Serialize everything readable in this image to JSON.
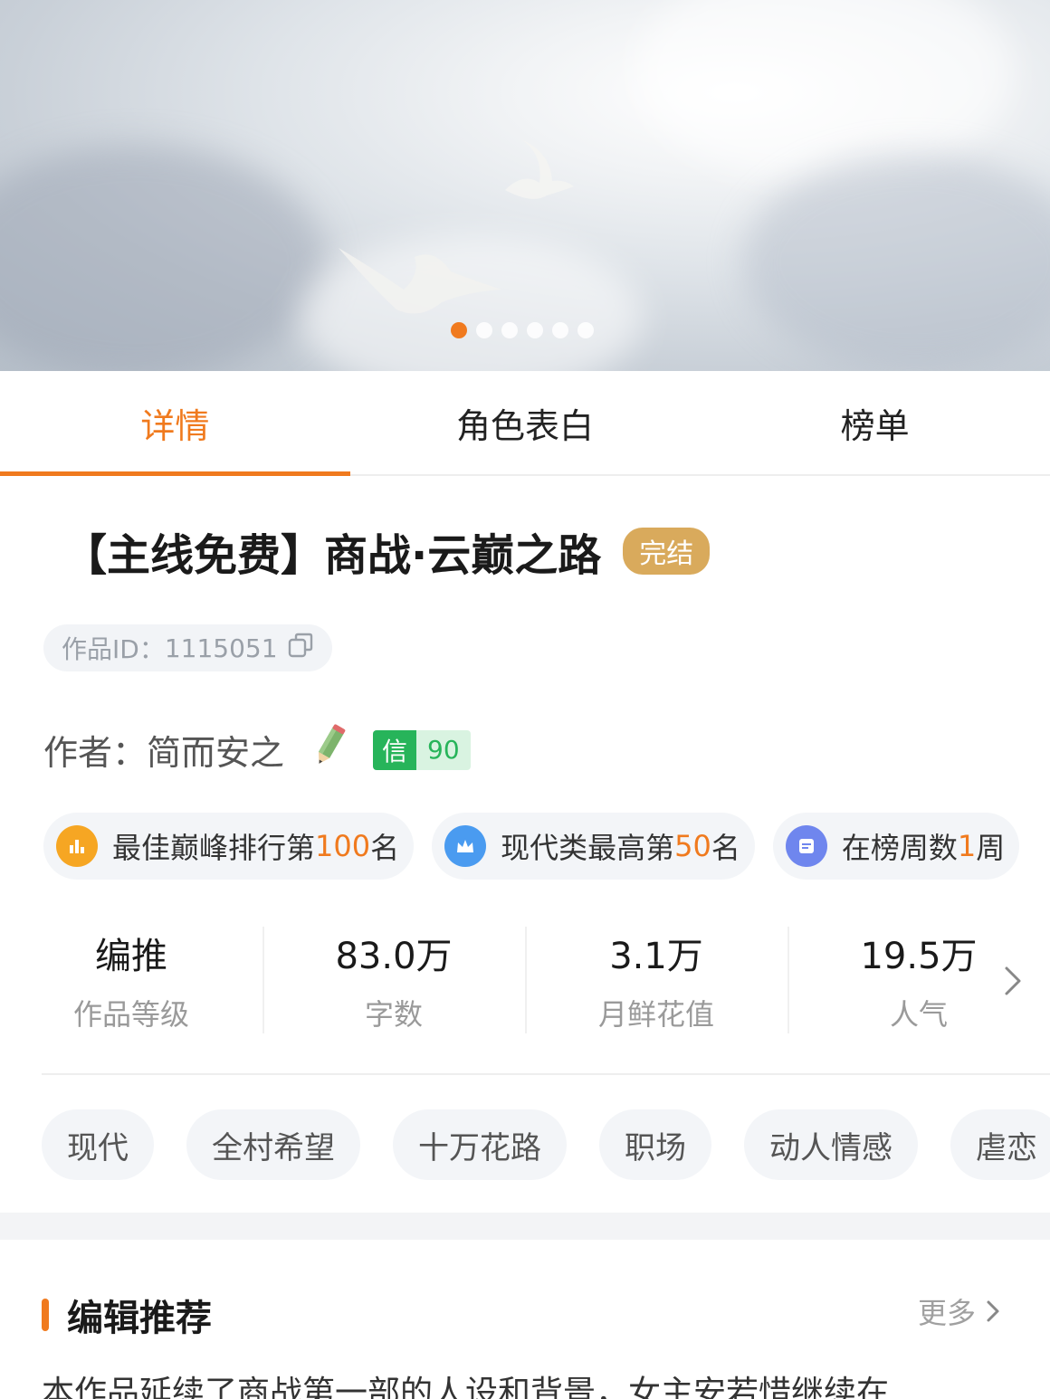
{
  "banner": {
    "carousel_dot_count": 6,
    "active_dot": 0,
    "colors": {
      "accent": "#f07a1e",
      "dot_inactive": "#ffffff"
    }
  },
  "tabs": [
    {
      "label": "详情",
      "active": true
    },
    {
      "label": "角色表白",
      "active": false
    },
    {
      "label": "榜单",
      "active": false
    }
  ],
  "work": {
    "title": "【主线免费】商战·云巅之路",
    "status": "完结",
    "id_label": "作品ID：",
    "id_value": "1115051",
    "author_label": "作者：",
    "author_name": "简而安之",
    "credit_label": "信",
    "credit_score": "90"
  },
  "ranks": [
    {
      "prefix": "最佳巅峰排行第",
      "num": "100",
      "suffix": "名",
      "icon": "bar-chart-icon",
      "color": "#f6a623"
    },
    {
      "prefix": "现代类最高第",
      "num": "50",
      "suffix": "名",
      "icon": "crown-icon",
      "color": "#4a9bf0"
    },
    {
      "prefix": "在榜周数",
      "num": "1",
      "suffix": "周",
      "icon": "list-icon",
      "color": "#6f86ee"
    }
  ],
  "stats": [
    {
      "value": "编推",
      "label": "作品等级"
    },
    {
      "value": "83.0万",
      "label": "字数"
    },
    {
      "value": "3.1万",
      "label": "月鲜花值"
    },
    {
      "value": "19.5万",
      "label": "人气"
    }
  ],
  "tags": [
    "现代",
    "全村希望",
    "十万花路",
    "职场",
    "动人情感",
    "虐恋"
  ],
  "editor": {
    "title": "编辑推荐",
    "more": "更多",
    "text": "本作品延续了商战第一部的人设和背景，女主安若惜继续在"
  }
}
